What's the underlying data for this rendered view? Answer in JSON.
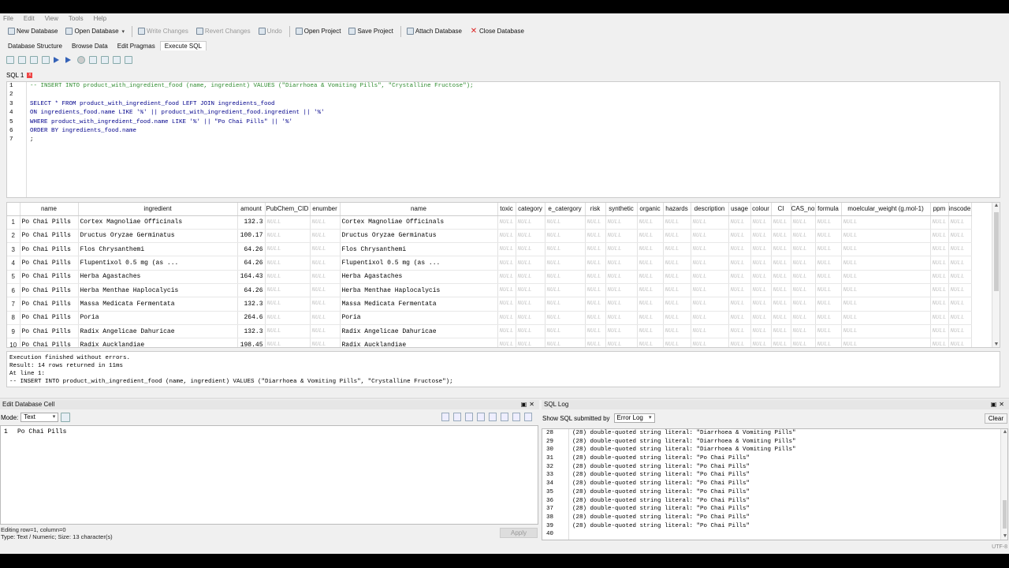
{
  "menu": [
    "File",
    "Edit",
    "View",
    "Tools",
    "Help"
  ],
  "toolbar": [
    {
      "label": "New Database",
      "icon": "new-database-icon",
      "disabled": false
    },
    {
      "label": "Open Database",
      "icon": "open-database-icon",
      "disabled": false
    },
    {
      "label": "Write Changes",
      "icon": "write-changes-icon",
      "disabled": true
    },
    {
      "label": "Revert Changes",
      "icon": "revert-changes-icon",
      "disabled": true
    },
    {
      "label": "Undo",
      "icon": "undo-icon",
      "disabled": true
    },
    {
      "label": "Open Project",
      "icon": "open-project-icon",
      "disabled": false
    },
    {
      "label": "Save Project",
      "icon": "save-project-icon",
      "disabled": false
    },
    {
      "label": "Attach Database",
      "icon": "attach-database-icon",
      "disabled": false
    },
    {
      "label": "Close Database",
      "icon": "close-database-icon",
      "disabled": false
    }
  ],
  "tabs": [
    "Database Structure",
    "Browse Data",
    "Edit Pragmas",
    "Execute SQL"
  ],
  "sql_tab": "SQL 1",
  "editor_lines": [
    "-- INSERT INTO product_with_ingredient_food (name, ingredient) VALUES (\"Diarrhoea & Vomiting Pills\", \"Crystalline Fructose\");",
    "",
    "SELECT * FROM product_with_ingredient_food LEFT JOIN ingredients_food",
    "ON ingredients_food.name LIKE '%' || product_with_ingredient_food.ingredient || '%'",
    "WHERE product_with_ingredient_food.name LIKE '%' || \"Po Chai Pills\" || '%'",
    "ORDER BY ingredients_food.name",
    ";"
  ],
  "grid": {
    "columns": [
      "name",
      "ingredient",
      "amount",
      "PubChem_CID",
      "enumber",
      "name",
      "toxic",
      "category",
      "e_catergory",
      "risk",
      "synthetic",
      "organic",
      "hazards",
      "description",
      "usage",
      "colour",
      "CI",
      "CAS_no",
      "formula",
      "moelcular_weight (g.mol-1)",
      "ppm",
      "inscode"
    ],
    "null_text": "NULL",
    "rows": [
      {
        "n": "1",
        "name": "Po Chai Pills",
        "ingredient": "Cortex Magnoliae Officinals",
        "amount": "132.3",
        "name2": "Cortex Magnoliae Officinals"
      },
      {
        "n": "2",
        "name": "Po Chai Pills",
        "ingredient": "Dructus Oryzae Germinatus",
        "amount": "100.17",
        "name2": "Dructus Oryzae Germinatus"
      },
      {
        "n": "3",
        "name": "Po Chai Pills",
        "ingredient": "Flos Chrysanthemi",
        "amount": "64.26",
        "name2": "Flos Chrysanthemi"
      },
      {
        "n": "4",
        "name": "Po Chai Pills",
        "ingredient": "Flupentixol 0.5 mg (as ...",
        "amount": "64.26",
        "name2": "Flupentixol 0.5 mg (as ..."
      },
      {
        "n": "5",
        "name": "Po Chai Pills",
        "ingredient": "Herba Agastaches",
        "amount": "164.43",
        "name2": "Herba Agastaches"
      },
      {
        "n": "6",
        "name": "Po Chai Pills",
        "ingredient": "Herba Menthae Haplocalycis",
        "amount": "64.26",
        "name2": "Herba Menthae Haplocalycis"
      },
      {
        "n": "7",
        "name": "Po Chai Pills",
        "ingredient": "Massa Medicata Fermentata",
        "amount": "132.3",
        "name2": "Massa Medicata Fermentata"
      },
      {
        "n": "8",
        "name": "Po Chai Pills",
        "ingredient": "Poria",
        "amount": "264.6",
        "name2": "Poria"
      },
      {
        "n": "9",
        "name": "Po Chai Pills",
        "ingredient": "Radix Angelicae Dahuricae",
        "amount": "132.3",
        "name2": "Radix Angelicae Dahuricae"
      },
      {
        "n": "10",
        "name": "Po Chai Pills",
        "ingredient": "Radix Aucklandiae",
        "amount": "198.45",
        "name2": "Radix Aucklandiae"
      }
    ]
  },
  "message": [
    "Execution finished without errors.",
    "Result: 14 rows returned in 11ms",
    "At line 1:",
    "-- INSERT INTO product_with_ingredient_food (name, ingredient) VALUES (\"Diarrhoea & Vomiting Pills\", \"Crystalline Fructose\");"
  ],
  "cell_panel": {
    "title": "Edit Database Cell",
    "mode_label": "Mode:",
    "mode_value": "Text",
    "line_no": "1",
    "value": "Po Chai Pills",
    "status1": "Editing row=1, column=0",
    "status2": "Type: Text / Numeric; Size: 13 character(s)",
    "apply": "Apply"
  },
  "log_panel": {
    "title": "SQL Log",
    "show_label": "Show SQL submitted by",
    "show_value": "Error Log",
    "clear": "Clear",
    "lines": [
      {
        "n": "28",
        "t": "(28) double-quoted string literal: \"Diarrhoea & Vomiting Pills\""
      },
      {
        "n": "29",
        "t": "(28) double-quoted string literal: \"Diarrhoea & Vomiting Pills\""
      },
      {
        "n": "30",
        "t": "(28) double-quoted string literal: \"Diarrhoea & Vomiting Pills\""
      },
      {
        "n": "31",
        "t": "(28) double-quoted string literal: \"Po Chai Pills\""
      },
      {
        "n": "32",
        "t": "(28) double-quoted string literal: \"Po Chai Pills\""
      },
      {
        "n": "33",
        "t": "(28) double-quoted string literal: \"Po Chai Pills\""
      },
      {
        "n": "34",
        "t": "(28) double-quoted string literal: \"Po Chai Pills\""
      },
      {
        "n": "35",
        "t": "(28) double-quoted string literal: \"Po Chai Pills\""
      },
      {
        "n": "36",
        "t": "(28) double-quoted string literal: \"Po Chai Pills\""
      },
      {
        "n": "37",
        "t": "(28) double-quoted string literal: \"Po Chai Pills\""
      },
      {
        "n": "38",
        "t": "(28) double-quoted string literal: \"Po Chai Pills\""
      },
      {
        "n": "39",
        "t": "(28) double-quoted string literal: \"Po Chai Pills\""
      },
      {
        "n": "40",
        "t": ""
      }
    ]
  },
  "statusbar": {
    "encoding": "UTF-8"
  }
}
